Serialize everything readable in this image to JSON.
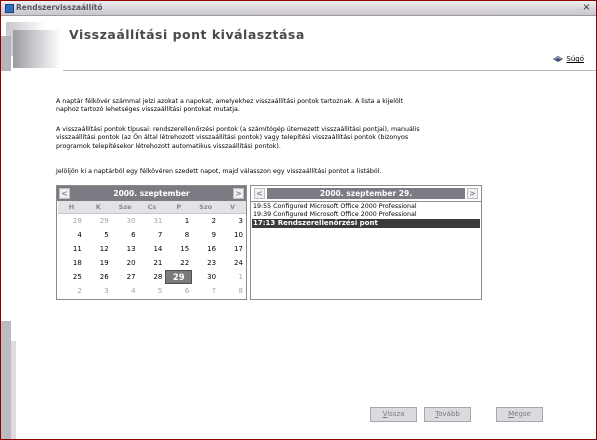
{
  "window": {
    "title": "Rendszervisszaállító",
    "close_glyph": "×"
  },
  "header": {
    "title": "Visszaállítási pont kiválasztása",
    "help_label": "Súgó"
  },
  "intro": {
    "p1_line1": "A naptár félkövér számmal jelzi azokat a napokat, amelyekhez visszaállítási pontok tartoznak. A lista a kijelölt",
    "p1_line2": "naphoz tartozó lehetséges visszaállítási pontokat mutatja.",
    "p2_line1": "A visszaállítási pontok típusai: rendszerellenőrzési pontok (a számítógép ütemezett visszaállítási pontjai), manuális",
    "p2_line2": "visszaállítási pontok (az Ön által létrehozott visszaállítási pontok) vagy telepítési visszaállítási pontok (bizonyos",
    "p2_line3": "programok telepítésekor létrehozott automatikus visszaállítási pontok).",
    "p3": "Jelöljön ki a naptárból egy félkövéren szedett napot, majd válasszon egy visszaállítási pontot a listából."
  },
  "calendar": {
    "title": "2000. szeptember",
    "prev": "<",
    "next": ">",
    "weekdays": [
      "H",
      "K",
      "Sze",
      "Cs",
      "P",
      "Szo",
      "V"
    ],
    "weeks": [
      [
        {
          "d": "28",
          "m": true
        },
        {
          "d": "29",
          "m": true
        },
        {
          "d": "30",
          "m": true
        },
        {
          "d": "31",
          "m": true
        },
        {
          "d": "1"
        },
        {
          "d": "2"
        },
        {
          "d": "3"
        }
      ],
      [
        {
          "d": "4"
        },
        {
          "d": "5"
        },
        {
          "d": "6"
        },
        {
          "d": "7"
        },
        {
          "d": "8"
        },
        {
          "d": "9"
        },
        {
          "d": "10"
        }
      ],
      [
        {
          "d": "11"
        },
        {
          "d": "12"
        },
        {
          "d": "13"
        },
        {
          "d": "14"
        },
        {
          "d": "15"
        },
        {
          "d": "16"
        },
        {
          "d": "17"
        }
      ],
      [
        {
          "d": "18"
        },
        {
          "d": "19"
        },
        {
          "d": "20"
        },
        {
          "d": "21"
        },
        {
          "d": "22"
        },
        {
          "d": "23"
        },
        {
          "d": "24"
        }
      ],
      [
        {
          "d": "25"
        },
        {
          "d": "26"
        },
        {
          "d": "27"
        },
        {
          "d": "28"
        },
        {
          "d": "29",
          "s": true
        },
        {
          "d": "30"
        },
        {
          "d": "1",
          "m": true
        }
      ],
      [
        {
          "d": "2",
          "m": true
        },
        {
          "d": "3",
          "m": true
        },
        {
          "d": "4",
          "m": true
        },
        {
          "d": "5",
          "m": true
        },
        {
          "d": "6",
          "m": true
        },
        {
          "d": "7",
          "m": true
        },
        {
          "d": "8",
          "m": true
        }
      ]
    ]
  },
  "restore_points": {
    "date_title": "2000. szeptember 29.",
    "prev": "<",
    "next": ">",
    "items": [
      {
        "text": "19:55 Configured Microsoft Office 2000 Professional",
        "selected": false
      },
      {
        "text": "19:39 Configured Microsoft Office 2000 Professional",
        "selected": false
      },
      {
        "text": "17:13 Rendszerellenőrzési pont",
        "selected": true
      }
    ]
  },
  "buttons": {
    "back": {
      "key": "V",
      "rest": "issza"
    },
    "next": {
      "key": "T",
      "rest": "ovább"
    },
    "cancel": {
      "key": "M",
      "rest": "égse"
    }
  },
  "colors": {
    "accent": "#7d7a84",
    "selected_item": "#3b3b3b",
    "frame": "#8c0000"
  }
}
